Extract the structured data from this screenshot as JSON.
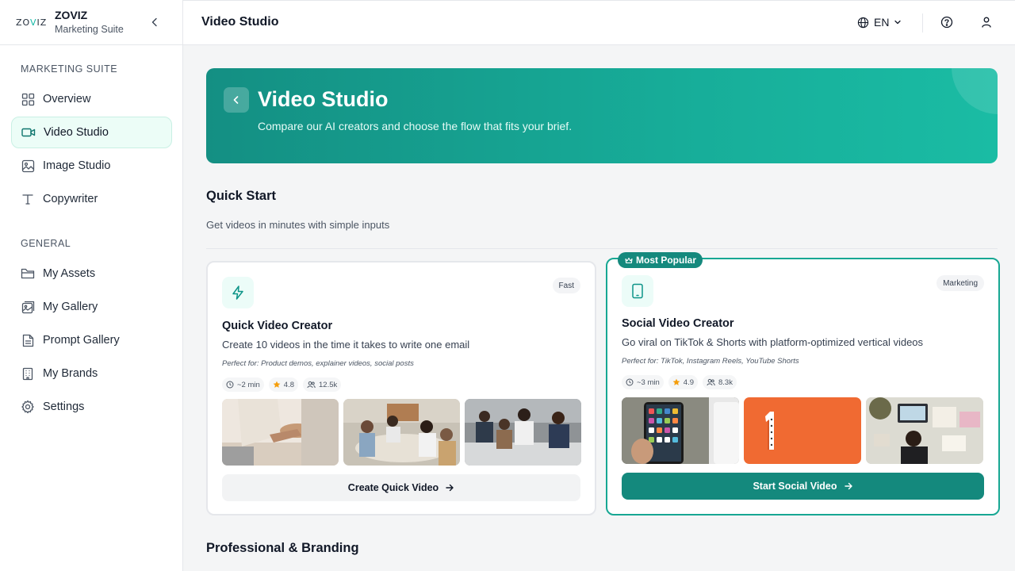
{
  "brand": {
    "logo_text": "ZOVIZ",
    "name": "ZOVIZ",
    "subtitle": "Marketing Suite"
  },
  "sidebar": {
    "sections": [
      {
        "title": "MARKETING SUITE"
      },
      {
        "title": "GENERAL"
      }
    ],
    "items": [
      {
        "label": "Overview",
        "icon": "grid-icon",
        "active": false
      },
      {
        "label": "Video Studio",
        "icon": "video-camera-icon",
        "active": true
      },
      {
        "label": "Image Studio",
        "icon": "image-icon",
        "active": false
      },
      {
        "label": "Copywriter",
        "icon": "text-t-icon",
        "active": false
      },
      {
        "label": "My Assets",
        "icon": "folder-icon",
        "active": false
      },
      {
        "label": "My Gallery",
        "icon": "gallery-icon",
        "active": false
      },
      {
        "label": "Prompt Gallery",
        "icon": "document-icon",
        "active": false
      },
      {
        "label": "My Brands",
        "icon": "building-icon",
        "active": false
      },
      {
        "label": "Settings",
        "icon": "gear-icon",
        "active": false
      }
    ]
  },
  "header": {
    "title": "Video Studio",
    "language": "EN"
  },
  "hero": {
    "title": "Video Studio",
    "subtitle": "Compare our AI creators and choose the flow that fits your brief."
  },
  "quick_start": {
    "title": "Quick Start",
    "description": "Get videos in minutes with simple inputs"
  },
  "cards": [
    {
      "tag": "Fast",
      "icon": "lightning-icon",
      "title": "Quick Video Creator",
      "description": "Create 10 videos in the time it takes to write one email",
      "perfect_for": "Perfect for: Product demos, explainer videos, social posts",
      "stats": {
        "time": "~2 min",
        "rating": "4.8",
        "users": "12.5k"
      },
      "cta": "Create Quick Video"
    },
    {
      "badge": "Most Popular",
      "tag": "Marketing",
      "icon": "phone-icon",
      "title": "Social Video Creator",
      "description": "Go viral on TikTok & Shorts with platform-optimized vertical videos",
      "perfect_for": "Perfect for: TikTok, Instagram Reels, YouTube Shorts",
      "stats": {
        "time": "~3 min",
        "rating": "4.9",
        "users": "8.3k"
      },
      "cta": "Start Social Video"
    }
  ],
  "next_section": {
    "title": "Professional & Branding"
  },
  "colors": {
    "accent": "#14897d",
    "accent_light": "#ecfdf7",
    "star": "#f59e0b"
  }
}
